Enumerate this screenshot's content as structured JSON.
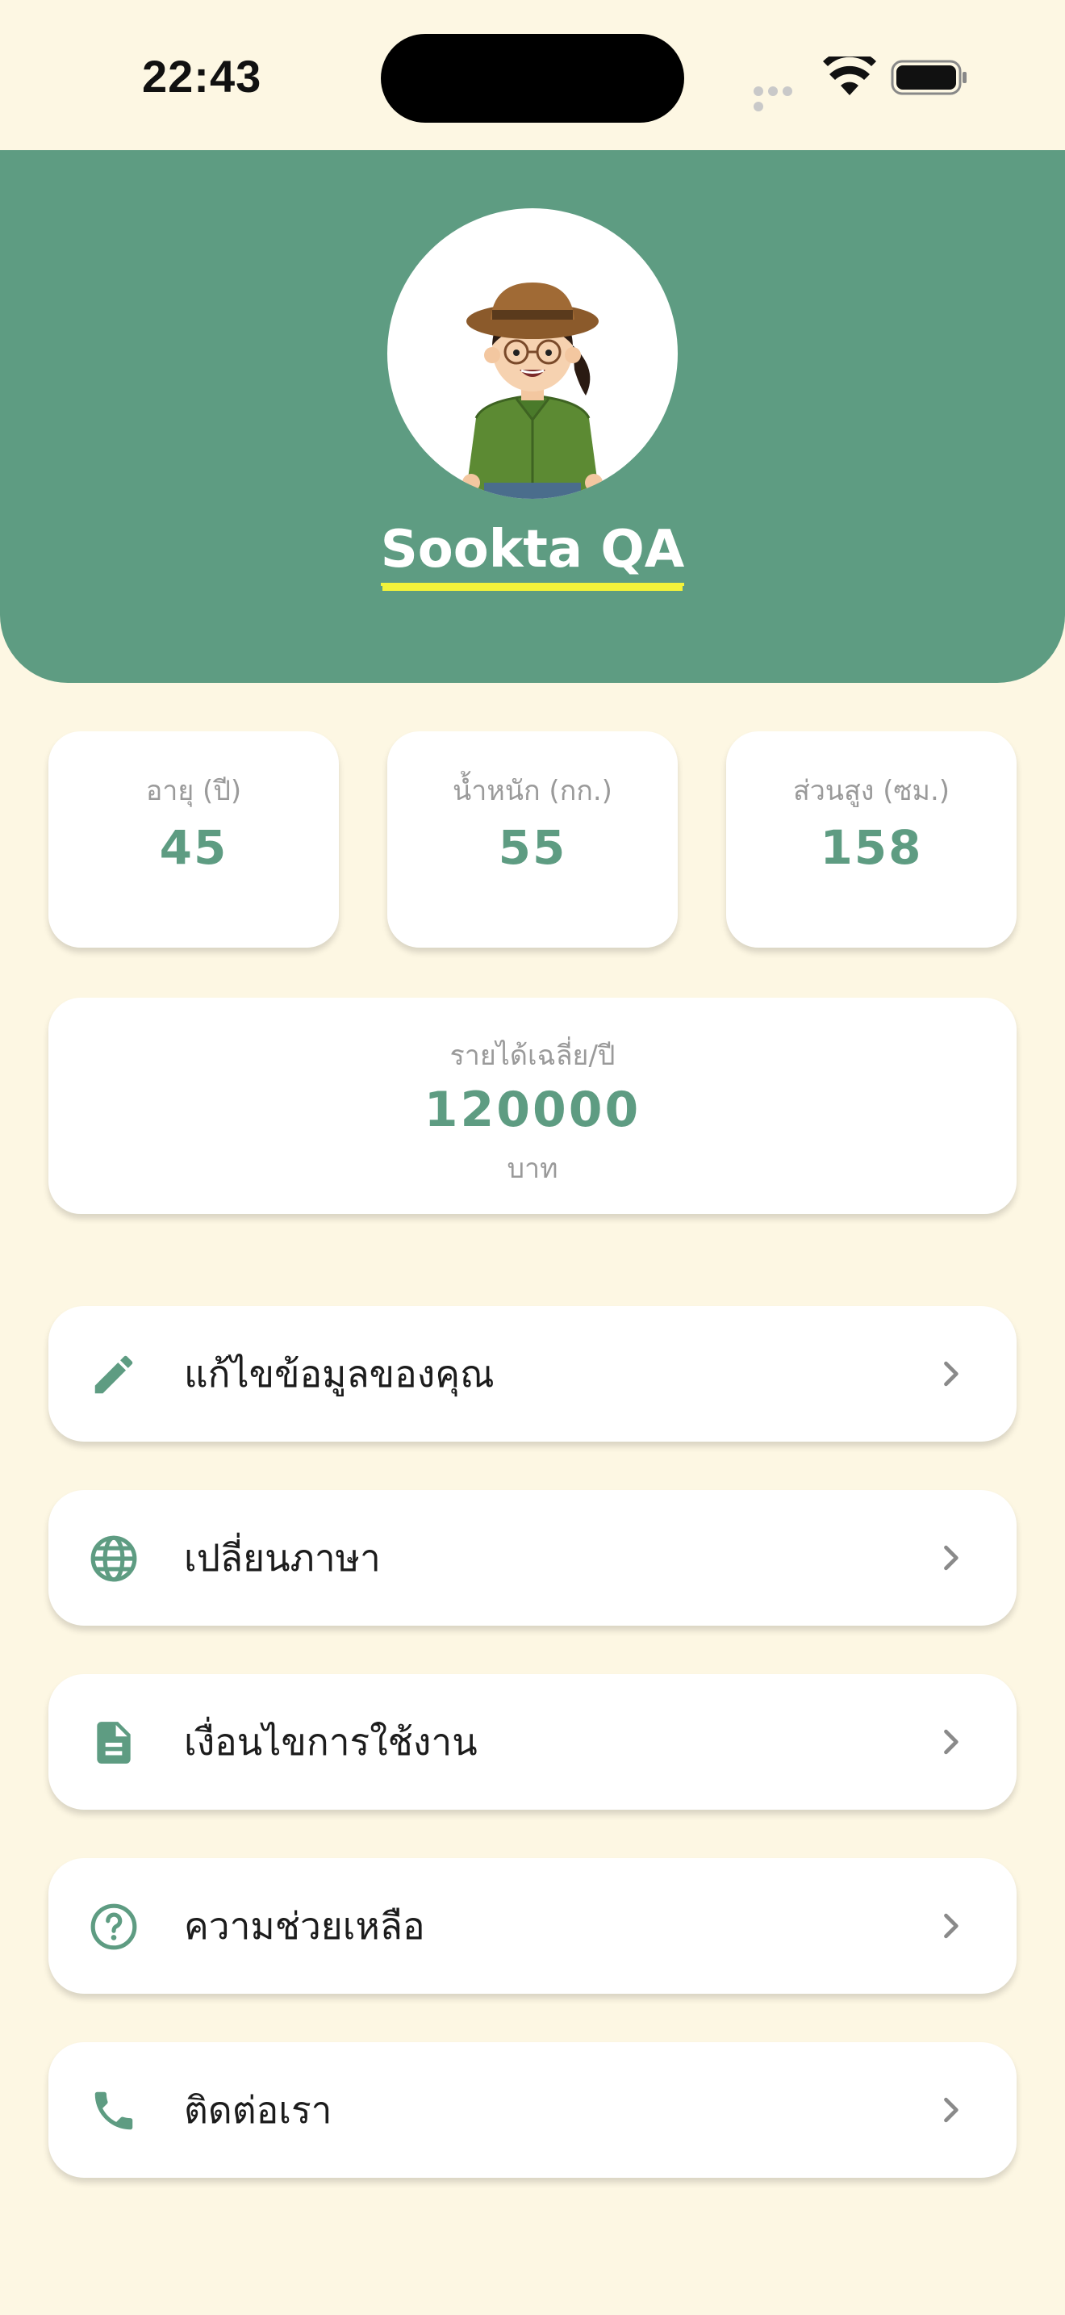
{
  "status_bar": {
    "time": "22:43"
  },
  "profile": {
    "name": "Sookta QA",
    "avatar_icon": "farmer-avatar"
  },
  "stats": [
    {
      "label": "อายุ (ปี)",
      "value": "45"
    },
    {
      "label": "น้ำหนัก (กก.)",
      "value": "55"
    },
    {
      "label": "ส่วนสูง (ซม.)",
      "value": "158"
    }
  ],
  "income": {
    "label": "รายได้เฉลี่ย/ปี",
    "value": "120000",
    "unit": "บาท"
  },
  "menu": [
    {
      "label": "แก้ไขข้อมูลของคุณ",
      "icon": "pencil-icon"
    },
    {
      "label": "เปลี่ยนภาษา",
      "icon": "globe-icon"
    },
    {
      "label": "เงื่อนไขการใช้งาน",
      "icon": "document-icon"
    },
    {
      "label": "ความช่วยเหลือ",
      "icon": "help-circle-icon"
    },
    {
      "label": "ติดต่อเรา",
      "icon": "phone-icon"
    }
  ],
  "colors": {
    "background": "#FDF7E3",
    "primary": "#5E9C82",
    "name_underline": "#F3F33A",
    "label_gray": "#9A9A9A"
  }
}
